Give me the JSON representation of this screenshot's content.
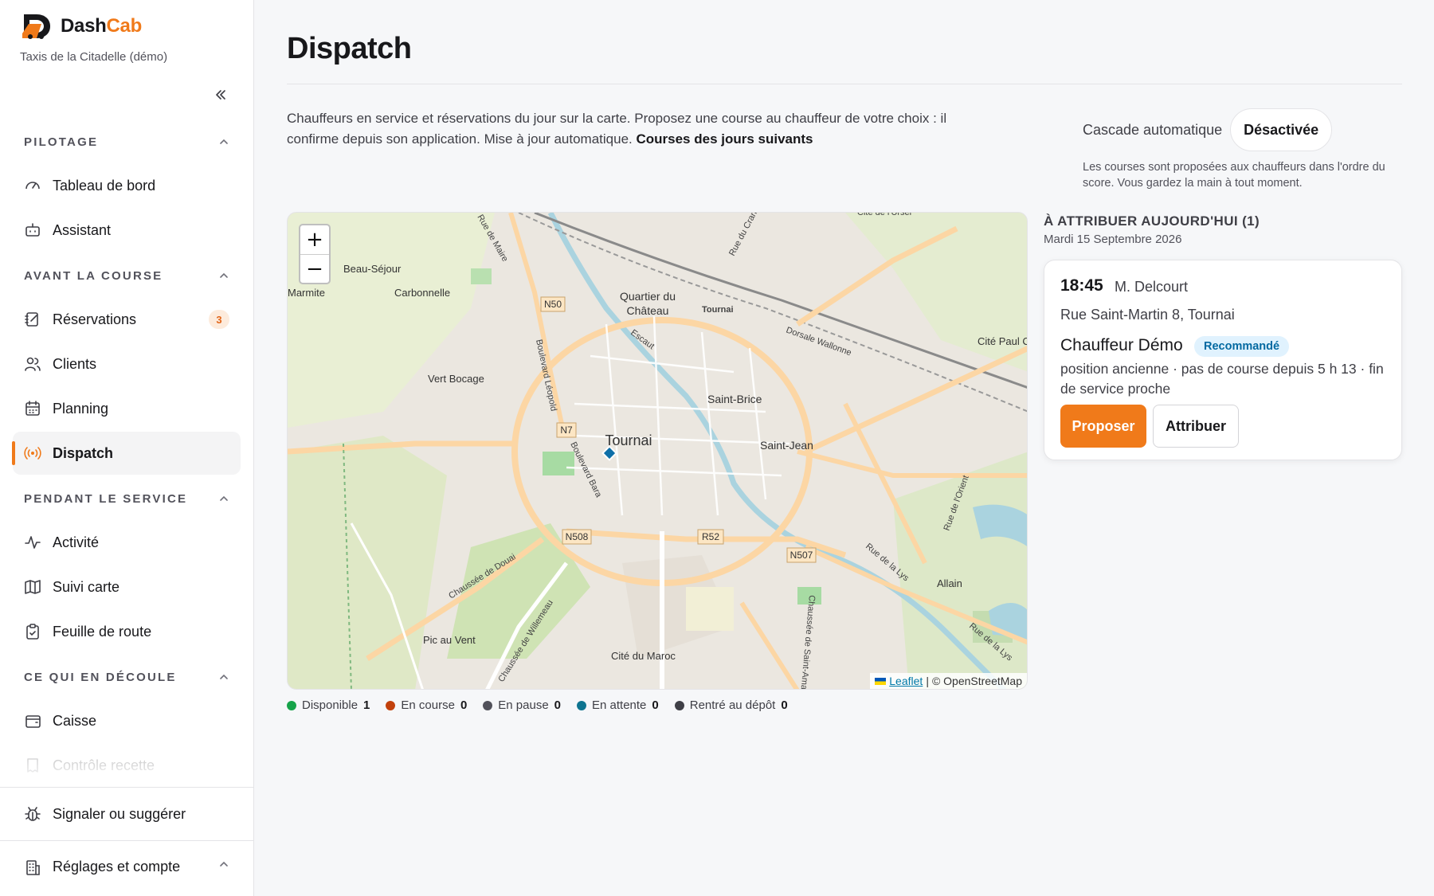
{
  "brand": {
    "name_primary": "Dash",
    "name_accent": "Cab",
    "subtitle": "Taxis de la Citadelle (démo)",
    "accent_color": "#f07a1a"
  },
  "sidebar": {
    "collapse_icon": "double-chevron-left-icon",
    "sections": [
      {
        "label": "Pilotage",
        "items": [
          {
            "label": "Tableau de bord",
            "icon": "gauge-icon"
          },
          {
            "label": "Assistant",
            "icon": "robot-icon"
          }
        ]
      },
      {
        "label": "Avant la course",
        "items": [
          {
            "label": "Réservations",
            "icon": "notebook-pen-icon",
            "badge": "3"
          },
          {
            "label": "Clients",
            "icon": "users-icon"
          },
          {
            "label": "Planning",
            "icon": "calendar-icon"
          },
          {
            "label": "Dispatch",
            "icon": "radio-broadcast-icon",
            "active": true
          }
        ]
      },
      {
        "label": "Pendant le service",
        "items": [
          {
            "label": "Activité",
            "icon": "activity-icon"
          },
          {
            "label": "Suivi carte",
            "icon": "map-icon"
          },
          {
            "label": "Feuille de route",
            "icon": "clipboard-check-icon"
          }
        ]
      },
      {
        "label": "Ce qui en découle",
        "items": [
          {
            "label": "Caisse",
            "icon": "wallet-icon"
          },
          {
            "label": "Contrôle recette",
            "icon": "receipt-icon"
          }
        ]
      }
    ],
    "bottom": {
      "report": {
        "label": "Signaler ou suggérer",
        "icon": "bug-icon"
      },
      "settings": {
        "label": "Réglages et compte",
        "icon": "building-icon"
      }
    }
  },
  "page": {
    "title": "Dispatch",
    "intro": "Chauffeurs en service et réservations du jour sur la carte. Proposez une course au chauffeur de votre choix : il confirme depuis son application. Mise à jour automatique.",
    "intro_link": "Courses des jours suivants"
  },
  "cascade": {
    "label": "Cascade automatique",
    "state": "Désactivée",
    "help": "Les courses sont proposées aux chauffeurs dans l'ordre du score. Vous gardez la main à tout moment."
  },
  "map": {
    "zoom_in": "+",
    "zoom_out": "−",
    "attribution_leaflet": "Leaflet",
    "attribution_sep": "|",
    "attribution_osm": "© OpenStreetMap",
    "places": [
      "Beau-Séjour",
      "Carbonnelle",
      "Marmite",
      "Quartier du",
      "Château",
      "Vert Bocage",
      "Saint-Brice",
      "Tournai",
      "Saint-Jean",
      "Cité Paul C",
      "Pic au Vent",
      "Cité du Maroc",
      "Allain"
    ],
    "roads": [
      "N50",
      "N7",
      "N508",
      "R52",
      "N507",
      "Boulevard Léopold",
      "Boulevard Bara",
      "Chaussée de Douai",
      "Escaut",
      "Tournai",
      "Dorsale Wallonne",
      "Rue de la Lys",
      "Chaussée de Saint-Amand",
      "Rue de l'Orient",
      "Rue du Cran",
      "Rue de Maire",
      "Chaussée de Willemeau",
      "Cité de l'Ursel"
    ]
  },
  "legend": [
    {
      "label": "Disponible",
      "count": "1",
      "color": "#16a34a"
    },
    {
      "label": "En course",
      "count": "0",
      "color": "#c2410c"
    },
    {
      "label": "En pause",
      "count": "0",
      "color": "#52525b"
    },
    {
      "label": "En attente",
      "count": "0",
      "color": "#0e7490"
    },
    {
      "label": "Rentré au dépôt",
      "count": "0",
      "color": "#3f3f46"
    }
  ],
  "panel": {
    "heading": "À attribuer aujourd'hui (1)",
    "date": "Mardi 15 Septembre 2026",
    "booking": {
      "time": "18:45",
      "client": "M. Delcourt",
      "address": "Rue Saint-Martin 8, Tournai",
      "driver": "Chauffeur Démo",
      "badge": "Recommandé",
      "reason": "position ancienne · pas de course depuis 5 h 13 · fin de service proche",
      "propose_label": "Proposer",
      "assign_label": "Attribuer"
    }
  }
}
